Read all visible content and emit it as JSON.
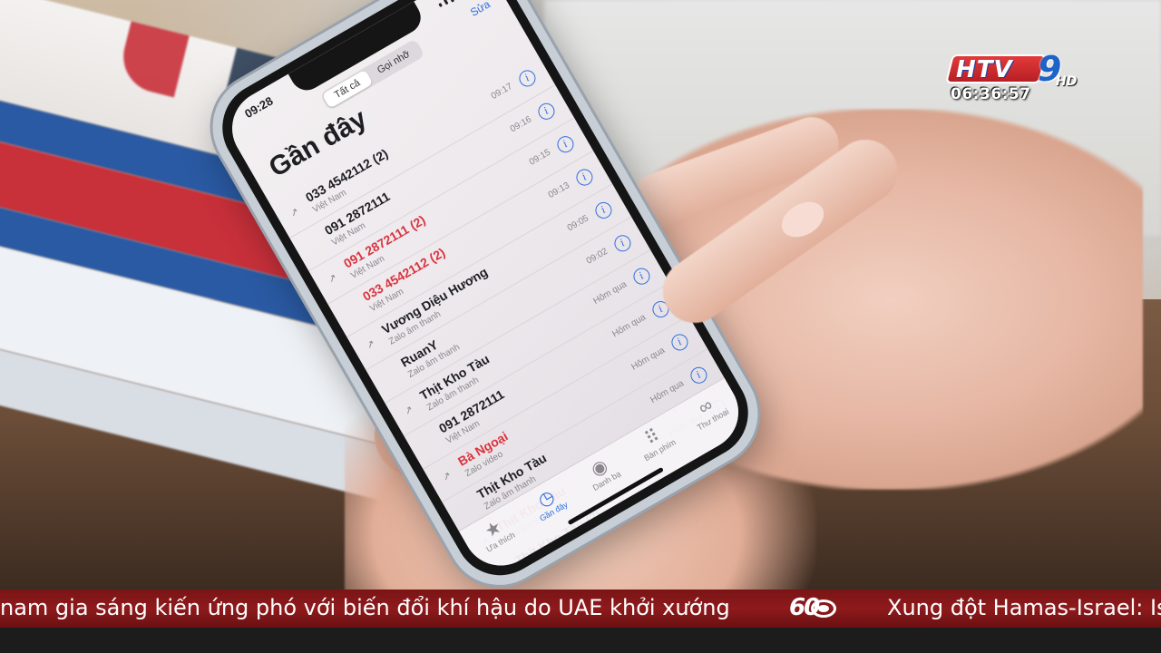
{
  "channel": {
    "logo_text": "HTV",
    "logo_number": "9",
    "logo_hd": "HD",
    "clock": "06:36:57"
  },
  "phone": {
    "status_time": "09:28",
    "segments": [
      "Tất cả",
      "Gọi nhỡ"
    ],
    "edit_label": "Sửa",
    "title": "Gần đây",
    "calls": [
      {
        "name": "033 4542112 (2)",
        "sub": "Việt Nam",
        "time": "09:17",
        "missed": false
      },
      {
        "name": "091 2872111",
        "sub": "Việt Nam",
        "time": "09:16",
        "missed": false
      },
      {
        "name": "091 2872111 (2)",
        "sub": "Việt Nam",
        "time": "09:15",
        "missed": true
      },
      {
        "name": "033 4542112 (2)",
        "sub": "Việt Nam",
        "time": "09:13",
        "missed": true
      },
      {
        "name": "Vương Diệu Hương",
        "sub": "Zalo âm thanh",
        "time": "09:05",
        "missed": false
      },
      {
        "name": "RuanY",
        "sub": "Zalo âm thanh",
        "time": "09:02",
        "missed": false
      },
      {
        "name": "Thịt Kho Tàu",
        "sub": "Zalo âm thanh",
        "time": "Hôm qua",
        "missed": false
      },
      {
        "name": "091 2872111",
        "sub": "Việt Nam",
        "time": "Hôm qua",
        "missed": false
      },
      {
        "name": "Bà Ngoại",
        "sub": "Zalo video",
        "time": "Hôm qua",
        "missed": true
      },
      {
        "name": "Thịt Kho Tàu",
        "sub": "Zalo âm thanh",
        "time": "Hôm qua",
        "missed": false
      },
      {
        "name": "Thịt Kho Tàu",
        "sub": "Zalo âm thanh",
        "time": "Hôm qua",
        "missed": true
      },
      {
        "name": "Thịt Kho Tàu (2)",
        "sub": "Zalo âm thanh",
        "time": "Hôm qua",
        "missed": false
      }
    ],
    "tabs": [
      {
        "label": "Ưa thích",
        "icon": "star-icon"
      },
      {
        "label": "Gần đây",
        "icon": "clock-icon"
      },
      {
        "label": "Danh bạ",
        "icon": "contacts-icon"
      },
      {
        "label": "Bàn phím",
        "icon": "keypad-icon"
      },
      {
        "label": "Thư thoại",
        "icon": "voicemail-icon"
      }
    ]
  },
  "ticker": {
    "headline_1": "nam gia sáng kiến ứng phó với biến đổi khí hậu do UAE khởi xướng",
    "badge": "60",
    "headline_2": "Xung đột Hamas-Israel: Is"
  }
}
